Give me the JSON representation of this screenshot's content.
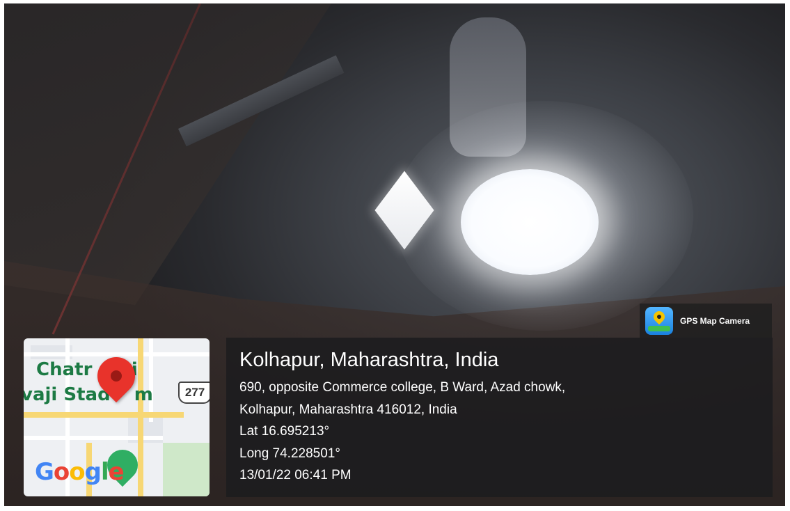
{
  "overlay": {
    "brand_label": "GPS Map Camera",
    "brand_icon": "gps-map-camera-icon",
    "location_title": "Kolhapur, Maharashtra, India",
    "address_line_1": "690, opposite Commerce college, B Ward, Azad chowk,",
    "address_line_2": "Kolhapur, Maharashtra 416012, India",
    "latitude": "Lat 16.695213°",
    "longitude": "Long 74.228501°",
    "datetime": "13/01/22 06:41 PM"
  },
  "map": {
    "place_label_line_1": "Chatr",
    "place_label_line_1_tail": "ti",
    "place_label_line_2": "vaji Stad",
    "place_label_line_2_tail": "m",
    "route_number": "277",
    "logo": "Google",
    "pin_icon": "location-pin-icon",
    "colors": {
      "pin": "#e8332b",
      "road": "#f7d774",
      "park": "#cfe8c9"
    }
  },
  "scene": {
    "subject": "ceiling light bulb"
  }
}
